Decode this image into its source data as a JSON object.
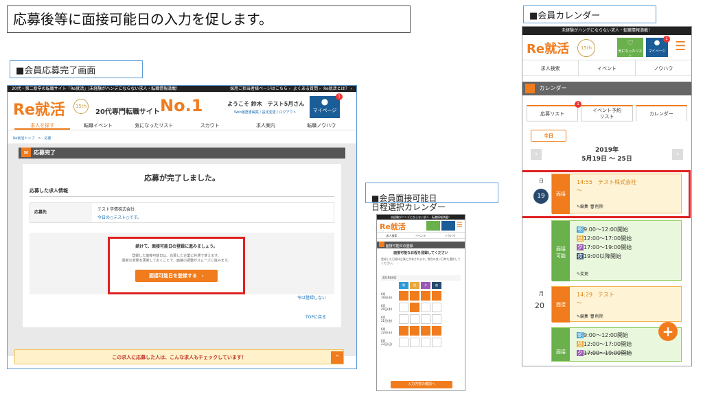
{
  "heading": "応募後等に面接可能日の入力を促します。",
  "labels": {
    "complete_screen": "■会員応募完了画面",
    "interview_calendar": "■会員面接可能日\n 日程選択カレンダー",
    "member_calendar": "■会員カレンダー"
  },
  "desktop": {
    "topbar_left": "20代・第二新卒の転職サイト「Re就活」|未経験がハンデにならない求人・転職情報満載！",
    "topbar_right": [
      "採用ご担当者様ページはこちら ›",
      "よくある質問 ›",
      "Re就活とは？ ›"
    ],
    "logo": "Re就活",
    "badge": "15th",
    "tagline": "20代専門転職サイト",
    "no1": "No.1",
    "welcome": "ようこそ 鈴木　テスト5月さん",
    "account_links": "Web履歴書編集 / 設定変更 / ログアウト",
    "mypage": "マイページ",
    "mypage_badge": "1",
    "nav": [
      "求人を探す",
      "転職イベント",
      "気になったリスト",
      "スカウト",
      "求人案内",
      "転職ノウハウ"
    ],
    "breadcrumb": "Re就活トップ　>　応募",
    "section_title": "応募完了",
    "complete_message": "応募が完了しました。",
    "info_title": "応募した求人情報",
    "table_label": "応募先",
    "company": "テスト学情株式会社",
    "company_note": "今日の○テスト○です。",
    "prompt_title": "続けて、面接可能日の登録に進みましょう。",
    "prompt_text1": "登録した面接可能日は、応募した企業に共通で使えます。",
    "prompt_text2": "最新の状態を更新しておくことで、面接の調整がスムーズに進みます。",
    "register_button": "面接可能日を登録する　›",
    "not_now": "今は登録しない",
    "top_link": "TOPに戻る",
    "banner": "この求人に応募した人は、こんな求人もチェックしています！"
  },
  "mobile_mid": {
    "topbar": "未経験がハンデにならない求人・転職情報満載！",
    "logo": "Re就活",
    "nav": [
      "求人検索",
      "イベント",
      "ノウハウ"
    ],
    "section": "面接可能日の登録",
    "heading": "面接可能な日程を登録してください",
    "desc": "登録した日程は企業と共有されます。都合の良い日時を選択してください。",
    "date_label": "2019年6月",
    "columns": [
      "朝",
      "昼",
      "夕",
      "夜"
    ],
    "rows": [
      "6月\n19日(水)",
      "6月\n20日(木)",
      "6月\n21日(金)",
      "6月\n22日(土)",
      "6月\n23日(日)"
    ],
    "confirm_button": "入力内容の確認へ"
  },
  "mobile_right": {
    "topbar": "未経験がハンデにならない求人・転職情報満載！",
    "logo": "Re就活",
    "badge": "15th",
    "fav": "気になったリスト",
    "mypage": "マイページ",
    "mypage_badge": "1",
    "nav": [
      "求人検索",
      "イベント",
      "ノウハウ"
    ],
    "section": "カレンダー",
    "tabs": [
      "応募リスト",
      "イベント予約\nリスト",
      "カレンダー"
    ],
    "tab_badge": "1",
    "today": "今日",
    "year": "2019年",
    "range": "5月19日 〜 25日",
    "day1_label": "日",
    "day1": "19",
    "ev1_type": "面接",
    "ev1_time": "14:55　テスト株式会社",
    "ev1_tilde": "〜",
    "edit": "編集",
    "delete": "削除",
    "avail_type": "面接\n可能",
    "slots": [
      {
        "mark": "朝",
        "text": "9:00〜12:00開始",
        "color": "#2e9bd6"
      },
      {
        "mark": "昼",
        "text": "12:00〜17:00開始",
        "color": "#e8a83a"
      },
      {
        "mark": "夕",
        "text": "17:00〜19:00開始",
        "color": "#9b59b6"
      },
      {
        "mark": "夜",
        "text": "19:00以降開始",
        "color": "#27496d"
      }
    ],
    "change": "変更",
    "day2_label": "月",
    "day2": "20",
    "ev2_type": "面接",
    "ev2_time": "14:29　テスト",
    "ev2_tilde": "〜",
    "slots2": [
      {
        "mark": "朝",
        "text": "9:00〜12:00開始",
        "color": "#2e9bd6"
      },
      {
        "mark": "昼",
        "text": "12:00〜17:00開始",
        "color": "#e8a83a"
      },
      {
        "mark": "夕",
        "text": "17:00〜19:00開始",
        "color": "#9b59b6"
      }
    ],
    "fab": "+"
  }
}
